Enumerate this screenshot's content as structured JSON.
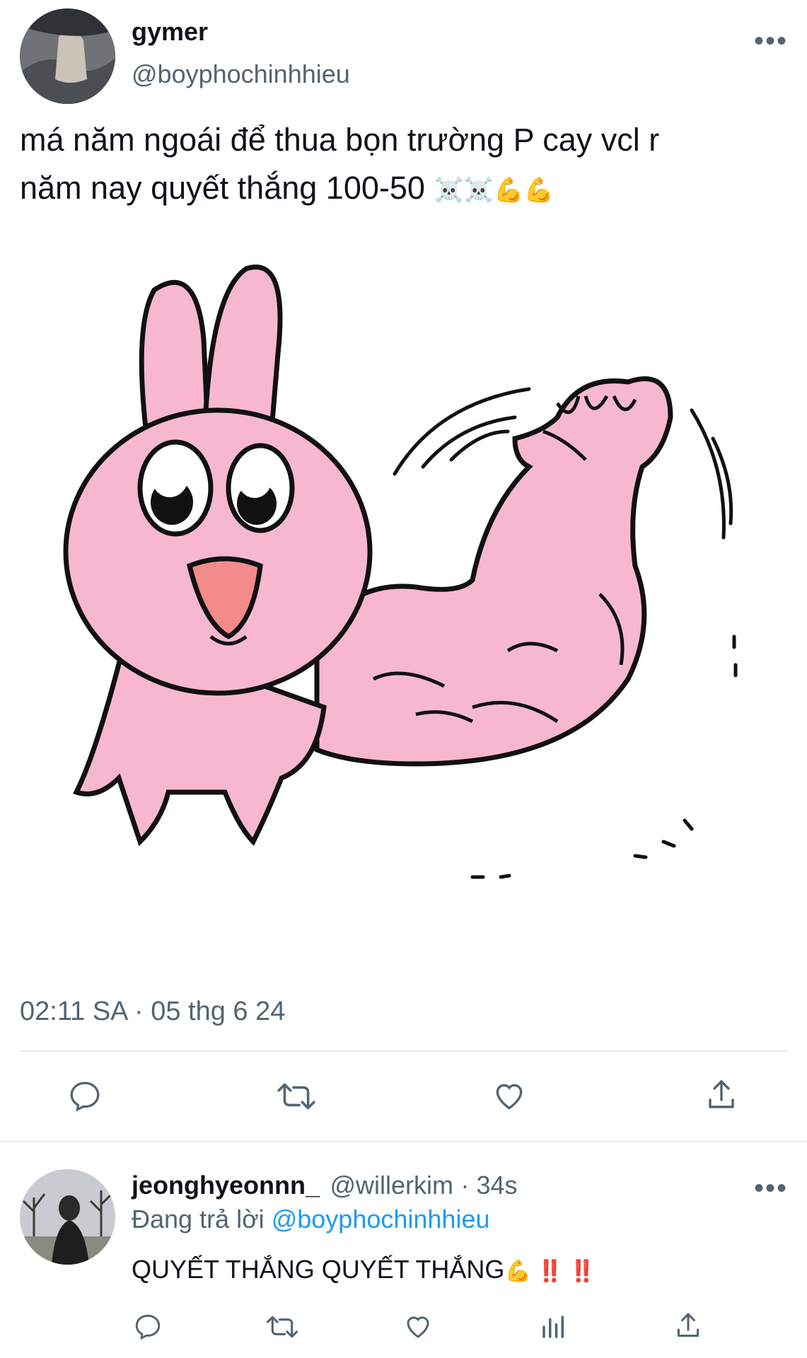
{
  "tweet": {
    "author_name": "gymer",
    "author_handle": "@boyphochinhhieu",
    "text_line1": "má năm ngoái để thua bọn trường P cay vcl r",
    "text_line2": "năm nay quyết thắng 100-50",
    "emojis": "☠️☠️💪💪",
    "timestamp": "02:11 SA · 05 thg 6 24",
    "actions": [
      "reply",
      "retweet",
      "like",
      "share"
    ]
  },
  "reply": {
    "author_name": "jeonghyeonnn_",
    "author_handle": "@willerkim",
    "time": "· 34s",
    "replying_prefix": "Đang trả lời",
    "replying_to": "@boyphochinhhieu",
    "text": "QUYẾT THẮNG QUYẾT THẮNG",
    "text_emojis": "💪 ‼️ ‼️",
    "actions": [
      "reply",
      "retweet",
      "like",
      "views",
      "share"
    ]
  },
  "icons": {
    "more": "more-horizontal-icon",
    "reply": "reply-icon",
    "retweet": "retweet-icon",
    "like": "heart-icon",
    "share": "share-icon",
    "views": "views-icon"
  },
  "colors": {
    "text": "#0f1419",
    "muted": "#536471",
    "link": "#1d9bf0",
    "bunny_pink": "#f7b8cf",
    "mouth": "#f38b8b"
  }
}
